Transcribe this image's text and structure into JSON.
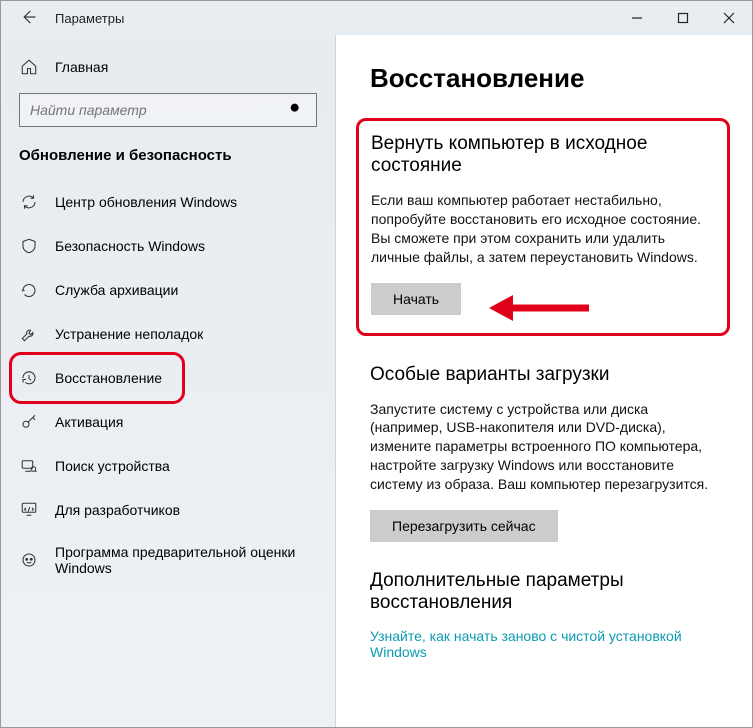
{
  "window": {
    "title": "Параметры"
  },
  "sidebar": {
    "home": "Главная",
    "search_placeholder": "Найти параметр",
    "section": "Обновление и безопасность",
    "items": [
      {
        "label": "Центр обновления Windows"
      },
      {
        "label": "Безопасность Windows"
      },
      {
        "label": "Служба архивации"
      },
      {
        "label": "Устранение неполадок"
      },
      {
        "label": "Восстановление"
      },
      {
        "label": "Активация"
      },
      {
        "label": "Поиск устройства"
      },
      {
        "label": "Для разработчиков"
      },
      {
        "label": "Программа предварительной оценки Windows"
      }
    ]
  },
  "page": {
    "title": "Восстановление",
    "reset": {
      "heading": "Вернуть компьютер в исходное состояние",
      "text": "Если ваш компьютер работает нестабильно, попробуйте восстановить его исходное состояние. Вы сможете при этом сохранить или удалить личные файлы, а затем переустановить Windows.",
      "button": "Начать"
    },
    "advanced": {
      "heading": "Особые варианты загрузки",
      "text": "Запустите систему с устройства или диска (например, USB-накопителя или DVD-диска), измените параметры встроенного ПО компьютера, настройте загрузку Windows или восстановите систему из образа. Ваш компьютер перезагрузится.",
      "button": "Перезагрузить сейчас"
    },
    "more": {
      "heading": "Дополнительные параметры восстановления",
      "link": "Узнайте, как начать заново с чистой установкой Windows"
    }
  }
}
